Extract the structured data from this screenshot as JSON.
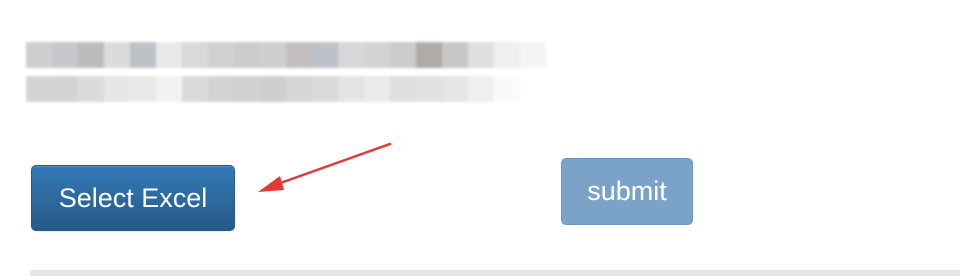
{
  "buttons": {
    "select_excel_label": "Select Excel",
    "submit_label": "submit"
  },
  "annotation": {
    "arrow_color": "#e53935"
  },
  "colors": {
    "primary": "#337ab7",
    "primary_dark": "#265a88",
    "submit_disabled": "#7ba3c7",
    "background": "#ffffff"
  },
  "redacted_row1": [
    "#c9c9cb",
    "#c2c3c6",
    "#b5b5b3",
    "#d8d8d6",
    "#b8bcc3",
    "#e6e6e4",
    "#d5d5d5",
    "#cccccc",
    "#c7c6c8",
    "#cacaca",
    "#bdb9b8",
    "#b8bbc2",
    "#d3d3d5",
    "#cfcfcf",
    "#c5c6c8",
    "#a8a29f",
    "#c2c2c2",
    "#dcdcdc",
    "#eeeeee",
    "#f4f4f4"
  ],
  "redacted_row2": [
    "#d0d0d0",
    "#cfcfd1",
    "#d8d8d8",
    "#e4e4e4",
    "#e6e6e6",
    "#f1f1f1",
    "#d6d6d6",
    "#cfcfcf",
    "#cdcdcd",
    "#c9c9c9",
    "#d2d2d2",
    "#d6d6d6",
    "#e2e2e2",
    "#e8e8e8",
    "#dcdcdc",
    "#e0dfdf",
    "#e4e4e4",
    "#eeeeee",
    "#fafafa",
    "#ffffff"
  ]
}
